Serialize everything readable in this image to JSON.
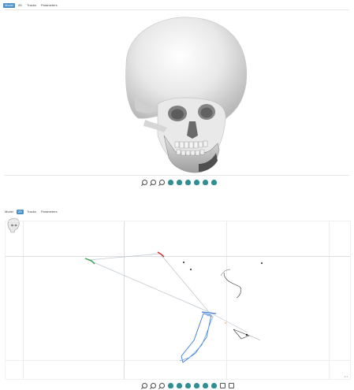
{
  "top": {
    "tabs": [
      {
        "label": "Model",
        "active": true
      },
      {
        "label": "2D",
        "active": false
      },
      {
        "label": "Tracks",
        "active": false
      },
      {
        "label": "Parameters",
        "active": false
      }
    ]
  },
  "bottom": {
    "tabs": [
      {
        "label": "Model",
        "active": false
      },
      {
        "label": "2D",
        "active": true
      },
      {
        "label": "Tracks",
        "active": false
      },
      {
        "label": "Parameters",
        "active": false
      }
    ],
    "corner_label": "1:1"
  },
  "colors": {
    "accent": "#4a90c8",
    "tool_head": "#2f8f92",
    "trace_blue": "#3d7bd6",
    "trace_red": "#d22a2a",
    "trace_green": "#2fa34a"
  }
}
